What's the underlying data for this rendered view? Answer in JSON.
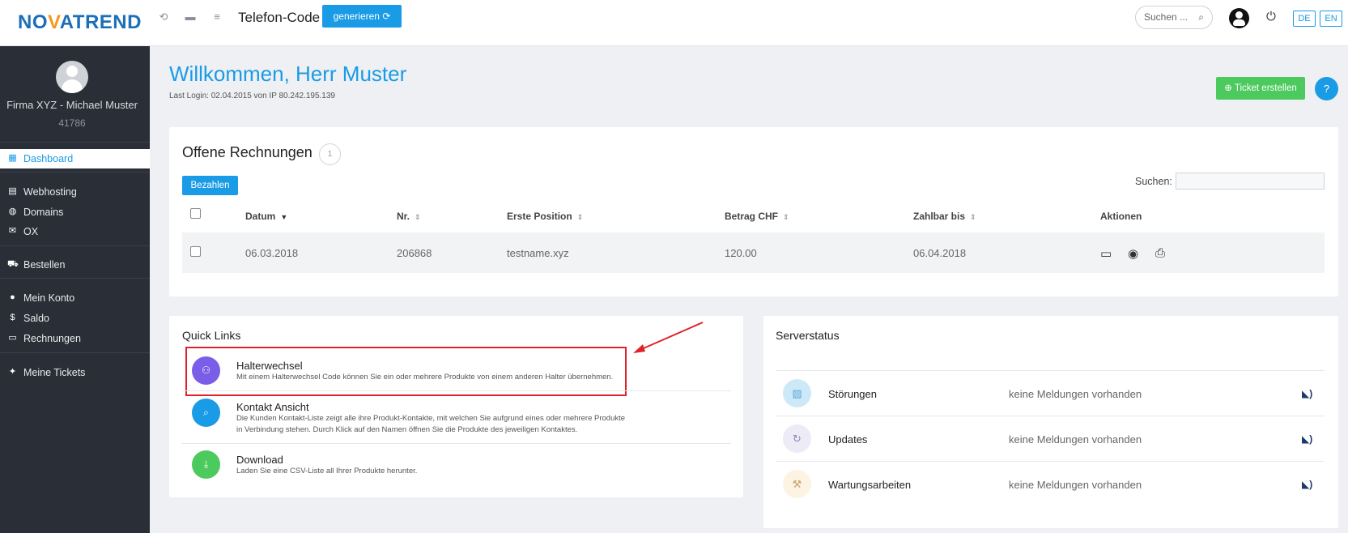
{
  "brand": {
    "part1": "NO",
    "part2": "V",
    "part3": "ATREND"
  },
  "header": {
    "page_title": "Telefon-Code",
    "generate_label": "generieren ⟳",
    "search_placeholder": "Suchen ...",
    "lang_de": "DE",
    "lang_en": "EN"
  },
  "sidebar": {
    "company": "Firma XYZ - Michael Muster",
    "customer_no": "41786",
    "items": [
      {
        "label": "Dashboard",
        "icon": "dashboard-icon"
      },
      {
        "label": "Webhosting",
        "icon": "server-icon"
      },
      {
        "label": "Domains",
        "icon": "globe-icon"
      },
      {
        "label": "OX",
        "icon": "mail-icon"
      },
      {
        "label": "Bestellen",
        "icon": "cart-icon"
      },
      {
        "label": "Mein Konto",
        "icon": "account-icon"
      },
      {
        "label": "Saldo",
        "icon": "dollar-icon"
      },
      {
        "label": "Rechnungen",
        "icon": "credit-card-icon"
      },
      {
        "label": "Meine Tickets",
        "icon": "ticket-icon"
      }
    ]
  },
  "main": {
    "welcome": "Willkommen, Herr Muster",
    "last_login": "Last Login: 02.04.2015 von IP 80.242.195.139",
    "ticket_button": "⊕ Ticket erstellen",
    "help_button": "?"
  },
  "invoices": {
    "title": "Offene Rechnungen",
    "count": "1",
    "pay_button": "Bezahlen",
    "search_label": "Suchen:",
    "columns": [
      "Datum",
      "Nr.",
      "Erste Position",
      "Betrag CHF",
      "Zahlbar bis",
      "Aktionen"
    ],
    "rows": [
      {
        "date": "06.03.2018",
        "nr": "206868",
        "position": "testname.xyz",
        "amount": "120.00",
        "due": "06.04.2018"
      }
    ]
  },
  "quick_links": {
    "title": "Quick Links",
    "items": [
      {
        "title": "Halterwechsel",
        "desc": "Mit einem Halterwechsel Code können Sie ein oder mehrere Produkte von einem anderen Halter übernehmen.",
        "color": "#7b5ee8"
      },
      {
        "title": "Kontakt Ansicht",
        "desc1": "Die Kunden Kontakt-Liste zeigt alle ihre Produkt-Kontakte, mit welchen Sie aufgrund eines oder mehrere Produkte",
        "desc2": "in Verbindung stehen. Durch Klick auf den Namen öffnen Sie die Produkte des jeweiligen Kontaktes.",
        "color": "#1a9be6"
      },
      {
        "title": "Download",
        "desc": "Laden Sie eine CSV-Liste all Ihrer Produkte herunter.",
        "color": "#4cca5e"
      }
    ]
  },
  "server_status": {
    "title": "Serverstatus",
    "items": [
      {
        "name": "Störungen",
        "msg": "keine Meldungen vorhanden"
      },
      {
        "name": "Updates",
        "msg": "keine Meldungen vorhanden"
      },
      {
        "name": "Wartungsarbeiten",
        "msg": "keine Meldungen vorhanden"
      }
    ]
  }
}
